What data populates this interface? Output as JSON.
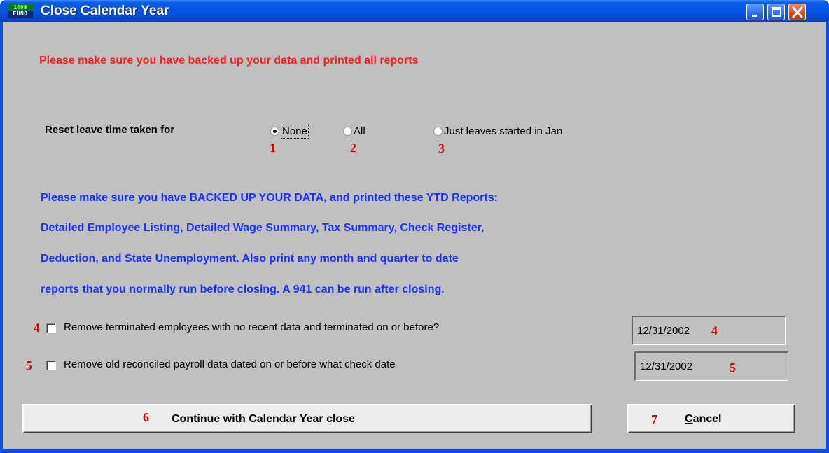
{
  "window": {
    "title": "Close Calendar Year",
    "icon": {
      "name": "fund-app-icon",
      "top_text": "1099",
      "bottom_text": "FUND"
    }
  },
  "warning_text": "Please make sure you have backed up your data and printed all reports",
  "reset_leave": {
    "label": "Reset leave time taken for",
    "options": [
      {
        "label": "None",
        "selected": true,
        "marker": "1"
      },
      {
        "label": "All",
        "selected": false,
        "marker": "2"
      },
      {
        "label": "Just leaves started in Jan",
        "selected": false,
        "marker": "3"
      }
    ]
  },
  "instructions": [
    "Please make sure you have BACKED UP YOUR DATA, and printed these YTD Reports:",
    "Detailed Employee Listing, Detailed Wage Summary, Tax Summary, Check Register,",
    "Deduction, and State Unemployment.  Also print any month and quarter to date",
    "reports that you normally run before closing.  A 941 can be run after closing."
  ],
  "options": [
    {
      "marker": "4",
      "label": "Remove terminated employees with no recent data and terminated on or before?",
      "checked": false,
      "date": "12/31/2002",
      "date_marker": "4"
    },
    {
      "marker": "5",
      "label": "Remove old reconciled payroll data dated on or before what check date",
      "checked": false,
      "date": "12/31/2002",
      "date_marker": "5"
    }
  ],
  "buttons": {
    "continue": {
      "label": "Continue with Calendar Year close",
      "marker": "6"
    },
    "cancel": {
      "label": "Cancel",
      "mnemonic": "C",
      "rest": "ancel",
      "marker": "7"
    }
  },
  "colors": {
    "titlebar": "#0553e0",
    "client_bg": "#c0c0c0",
    "warning_red": "#ff1a1a",
    "instruction_blue": "#1a2fff",
    "marker_red": "#e00000"
  }
}
